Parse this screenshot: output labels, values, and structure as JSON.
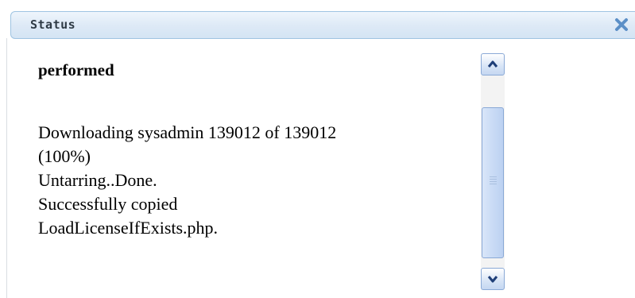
{
  "dialog": {
    "title": "Status",
    "close_icon": "close-x-icon"
  },
  "log": {
    "heading": "performed",
    "lines": [
      "Downloading sysadmin 139012 of 139012",
      "(100%)",
      "Untarring..Done.",
      "Successfully copied",
      "LoadLicenseIfExists.php."
    ]
  },
  "scrollbar": {
    "up_icon": "chevron-up-icon",
    "down_icon": "chevron-down-icon"
  },
  "colors": {
    "titlebar_border": "#9fc4e2",
    "titlebar_bg": "#dde9f6",
    "close_icon": "#5b8fc7",
    "scroll_border": "#8aa9d6"
  }
}
